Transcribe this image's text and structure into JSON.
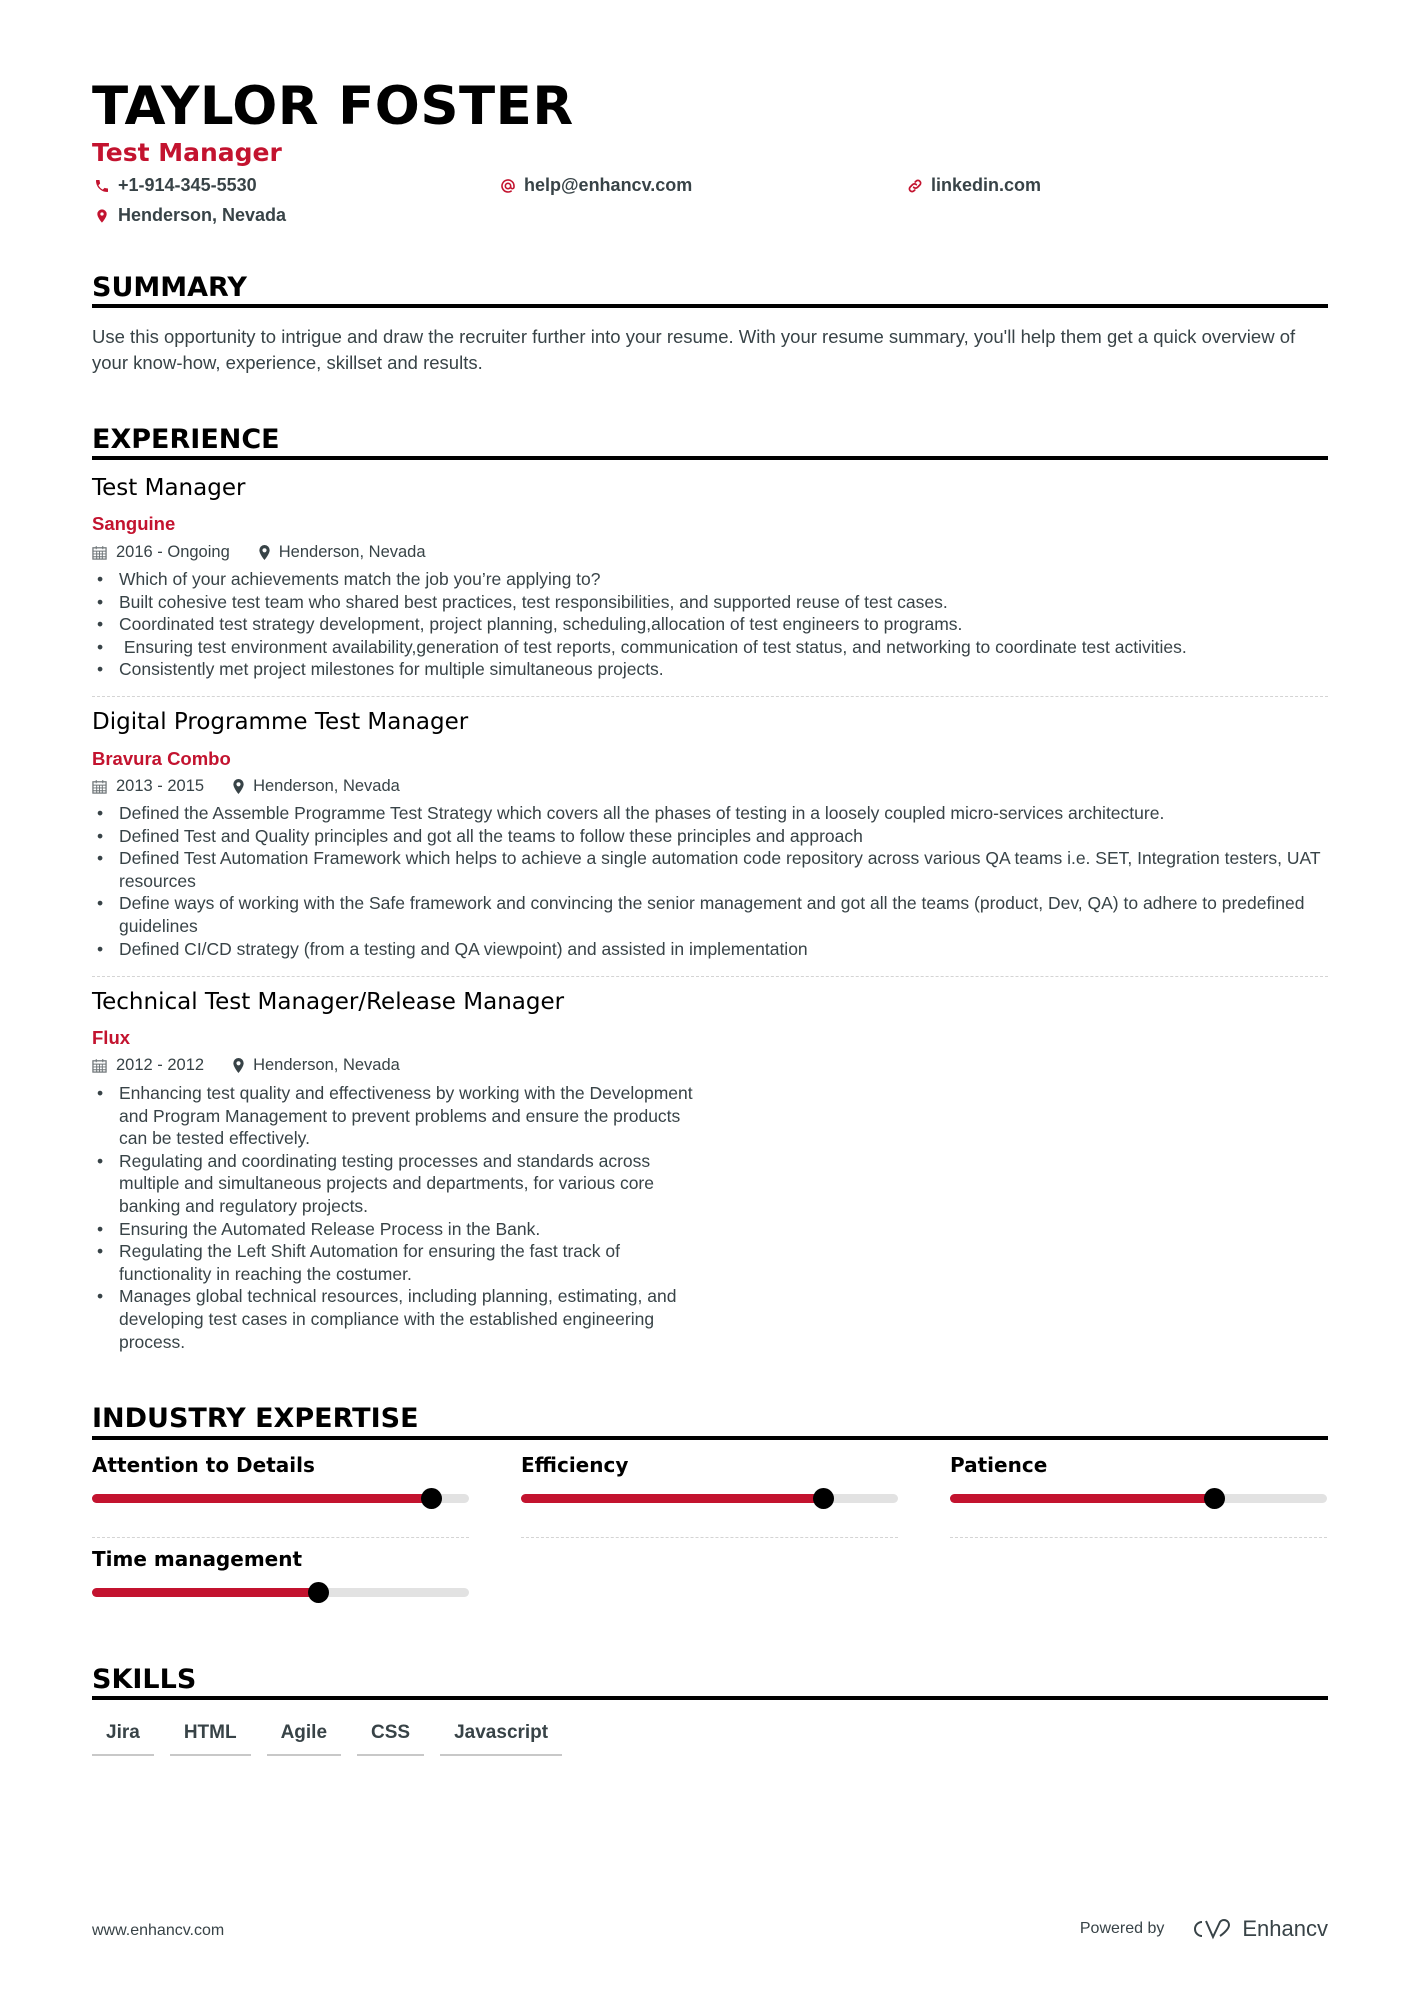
{
  "header": {
    "name": "TAYLOR FOSTER",
    "title": "Test Manager",
    "phone": "+1-914-345-5530",
    "email": "help@enhancv.com",
    "link": "linkedin.com",
    "location": "Henderson, Nevada",
    "icons": {
      "phone": "phone-icon",
      "email": "at-icon",
      "link": "link-icon",
      "location": "location-pin-icon"
    }
  },
  "colors": {
    "accent": "#c3132f",
    "text": "#384347",
    "heading": "#000000",
    "track": "#e2e2e2"
  },
  "summary": {
    "heading": "SUMMARY",
    "text": "Use this opportunity to intrigue and draw the recruiter further into your resume. With your resume summary, you'll help them get a quick overview of your know-how, experience, skillset and results."
  },
  "experience": {
    "heading": "EXPERIENCE",
    "jobs": [
      {
        "title": "Test Manager",
        "company": "Sanguine",
        "dates": "2016 - Ongoing",
        "location": "Henderson, Nevada",
        "bullets": [
          "Which of your achievements match the job you’re applying to?",
          "Built cohesive test team who shared best practices, test responsibilities, and supported reuse of test cases.",
          "Coordinated test strategy development, project planning, scheduling,allocation of test engineers to programs.",
          " Ensuring test environment availability,generation of test reports, communication of test status, and networking to coordinate test activities.",
          "Consistently met project milestones for multiple simultaneous projects."
        ]
      },
      {
        "title": "Digital Programme Test Manager",
        "company": "Bravura Combo",
        "dates": "2013 - 2015",
        "location": "Henderson, Nevada",
        "bullets": [
          "Defined the Assemble Programme Test Strategy which covers all the phases of testing in a loosely coupled micro-services architecture.",
          "Defined Test and Quality principles and got all the teams to follow these principles and approach",
          "Defined Test Automation Framework which helps to achieve a single automation code repository across various QA teams i.e. SET, Integration testers, UAT resources",
          "Define ways of working with the Safe framework and convincing the senior management and got all the teams (product, Dev, QA) to adhere to predefined guidelines",
          "Defined CI/CD strategy (from a testing and QA viewpoint) and assisted in implementation"
        ]
      },
      {
        "title": "Technical Test Manager/Release Manager",
        "company": "Flux",
        "dates": "2012 - 2012",
        "location": "Henderson, Nevada",
        "bullets": [
          "Enhancing test quality and effectiveness by working with the Development and Program Management to prevent problems and ensure the products can be tested effectively.",
          "Regulating and coordinating testing processes and standards across multiple and simultaneous projects and departments, for various core banking and regulatory projects.",
          "Ensuring the Automated Release Process in the Bank.",
          "Regulating the Left Shift Automation for ensuring the fast track of functionality in reaching the costumer.",
          "Manages global technical resources, including planning, estimating, and developing test cases in compliance with the established engineering process."
        ]
      }
    ]
  },
  "expertise": {
    "heading": "INDUSTRY EXPERTISE",
    "items": [
      {
        "label": "Attention to Details",
        "level": 0.9
      },
      {
        "label": "Efficiency",
        "level": 0.8
      },
      {
        "label": "Patience",
        "level": 0.7
      },
      {
        "label": "Time management",
        "level": 0.6
      }
    ]
  },
  "skills": {
    "heading": "SKILLS",
    "items": [
      "Jira",
      "HTML",
      "Agile",
      "CSS",
      "Javascript"
    ]
  },
  "footer": {
    "website": "www.enhancv.com",
    "powered_by": "Powered by",
    "brand": "Enhancv"
  }
}
